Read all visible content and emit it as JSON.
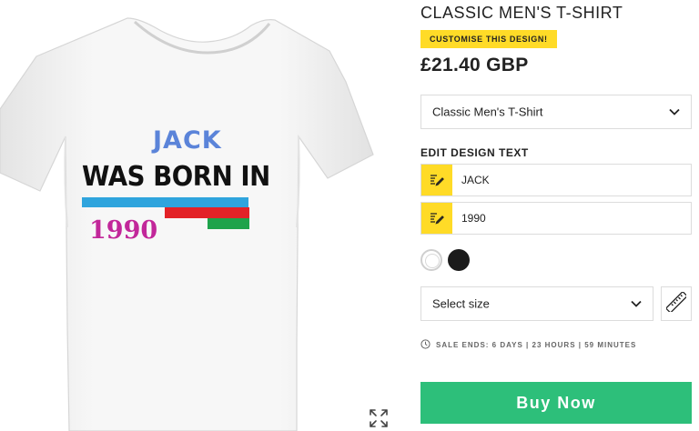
{
  "product": {
    "title": "CLASSIC MEN'S T-SHIRT",
    "customise_label": "CUSTOMISE THIS DESIGN!",
    "price": "£21.40 GBP",
    "style_selected": "Classic Men's T-Shirt"
  },
  "design": {
    "name_line": "JACK",
    "middle_line": "WAS BORN IN",
    "year_line": "1990",
    "colors": {
      "name": "#5b84d9",
      "year": "#c2279a",
      "blue_bar": "#2fa4dd",
      "red_bar": "#e32227",
      "green_bar": "#1ea34b"
    }
  },
  "edit": {
    "label": "EDIT DESIGN TEXT",
    "fields": [
      {
        "value": "JACK",
        "icon": "edit-text-icon"
      },
      {
        "value": "1990",
        "icon": "edit-text-icon"
      }
    ]
  },
  "colors": {
    "swatches": [
      {
        "name": "white",
        "hex": "#ffffff",
        "selected": true
      },
      {
        "name": "black",
        "hex": "#1b1b1b",
        "selected": false
      }
    ],
    "accent_yellow": "#ffdb27",
    "buy_green": "#2dbf7a"
  },
  "size": {
    "placeholder": "Select size",
    "guide_icon": "ruler-icon"
  },
  "sale": {
    "text": "SALE ENDS: 6 DAYS | 23 HOURS | 59 MINUTES"
  },
  "actions": {
    "buy_label": "Buy Now",
    "expand_icon": "expand-icon"
  }
}
